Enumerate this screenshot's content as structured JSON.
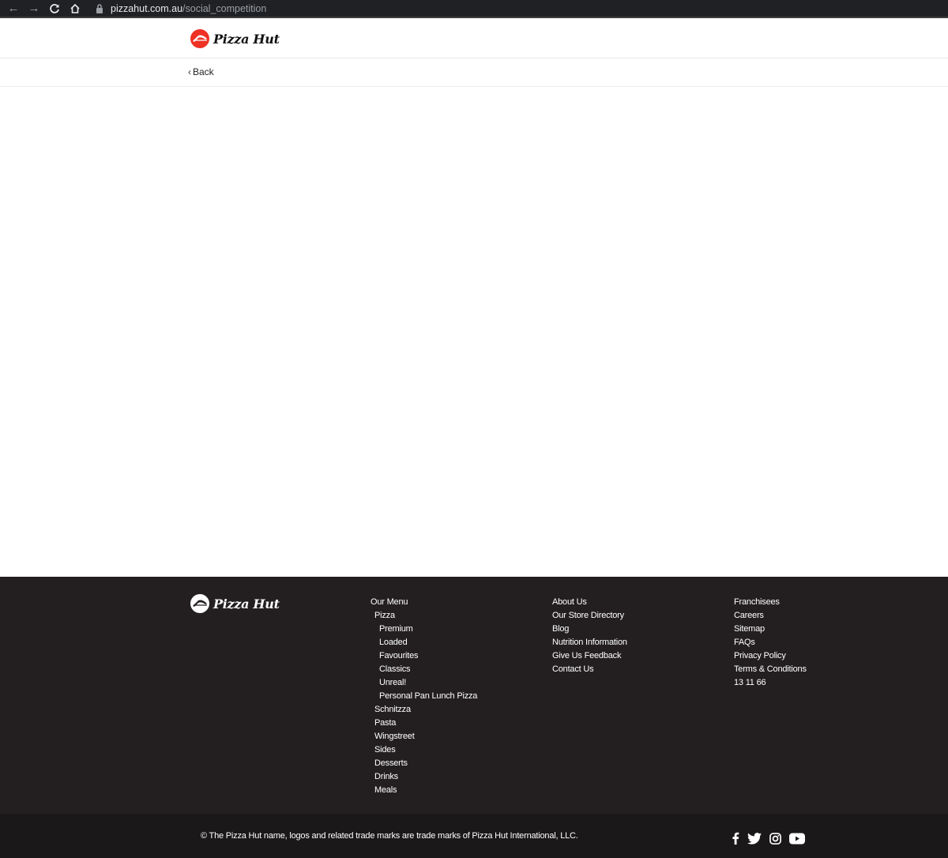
{
  "browser": {
    "url_domain": "pizzahut.com.au",
    "url_path": "/social_competition"
  },
  "header": {
    "logo_text": "Pizza Hut",
    "back_label": "Back"
  },
  "footer": {
    "logo_text": "Pizza Hut",
    "menu_column": [
      {
        "label": "Our Menu",
        "level": 0
      },
      {
        "label": "Pizza",
        "level": 1
      },
      {
        "label": "Premium",
        "level": 2
      },
      {
        "label": "Loaded",
        "level": 2
      },
      {
        "label": "Favourites",
        "level": 2
      },
      {
        "label": "Classics",
        "level": 2
      },
      {
        "label": "Unreal!",
        "level": 2
      },
      {
        "label": "Personal Pan Lunch Pizza",
        "level": 2
      },
      {
        "label": "Schnitzza",
        "level": 1
      },
      {
        "label": "Pasta",
        "level": 1
      },
      {
        "label": "Wingstreet",
        "level": 1
      },
      {
        "label": "Sides",
        "level": 1
      },
      {
        "label": "Desserts",
        "level": 1
      },
      {
        "label": "Drinks",
        "level": 1
      },
      {
        "label": "Meals",
        "level": 1
      }
    ],
    "about_column": [
      "About Us",
      "Our Store Directory",
      "Blog",
      "Nutrition Information",
      "Give Us Feedback",
      "Contact Us"
    ],
    "other_column": [
      "Franchisees",
      "Careers",
      "Sitemap",
      "FAQs",
      "Privacy Policy",
      "Terms & Conditions",
      "13 11 66"
    ],
    "copyright": "© The Pizza Hut name, logos and related trade marks are trade marks of Pizza Hut International, LLC.",
    "social_icons": [
      "facebook-icon",
      "twitter-icon",
      "instagram-icon",
      "youtube-icon"
    ]
  },
  "colors": {
    "brand_red": "#ee3124",
    "footer_bg": "#231f20",
    "bottom_bar_bg": "#1b1819"
  }
}
